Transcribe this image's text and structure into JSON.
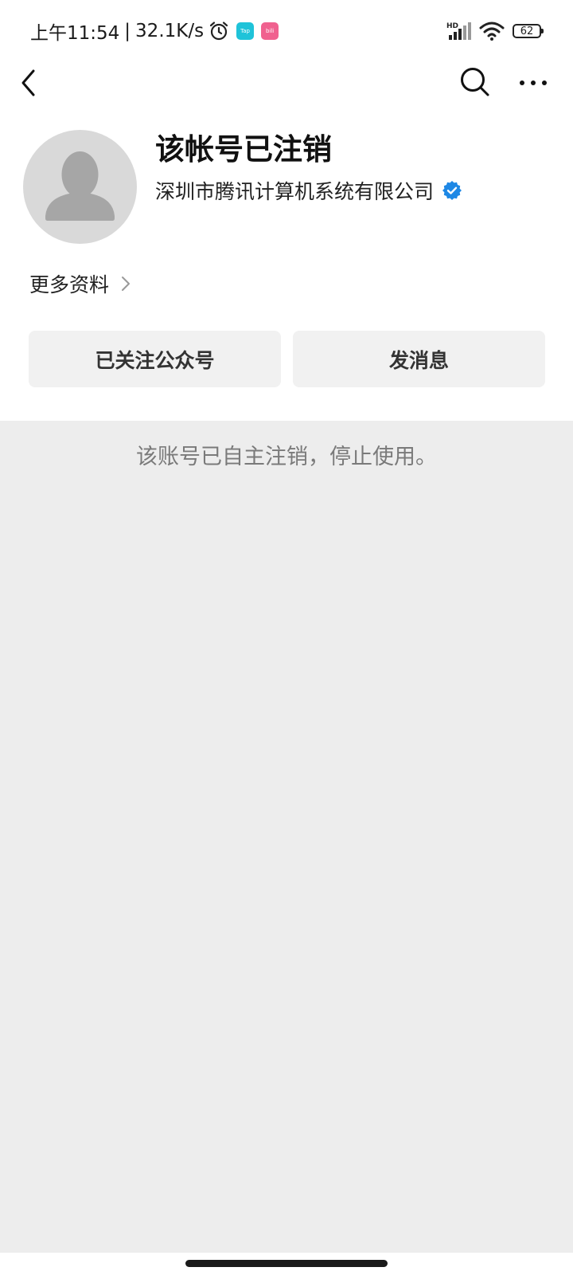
{
  "status_bar": {
    "time": "上午11:54",
    "separator": "|",
    "net_speed": "32.1K/s",
    "icons": [
      "alarm-icon",
      "tap-app-icon",
      "bilibili-app-icon",
      "hd-signal-icon",
      "wifi-icon",
      "battery-icon"
    ],
    "tap_label": "Tap",
    "bili_label": "bili",
    "signal_label": "HD",
    "battery": "62"
  },
  "nav": {
    "back_icon": "chevron-left-icon",
    "search_icon": "search-icon",
    "more_icon": "more-dots-icon"
  },
  "profile": {
    "name": "该帐号已注销",
    "company": "深圳市腾讯计算机系统有限公司",
    "verified_color": "#1e88e5",
    "more_info_label": "更多资料"
  },
  "actions": {
    "follow_label": "已关注公众号",
    "message_label": "发消息"
  },
  "notice": "该账号已自主注销，停止使用。",
  "colors": {
    "page_bg": "#ededed",
    "header_bg": "#ffffff",
    "button_bg": "#f1f1f1",
    "tap_badge": "#1fc3d9",
    "bili_badge": "#f0618f"
  }
}
